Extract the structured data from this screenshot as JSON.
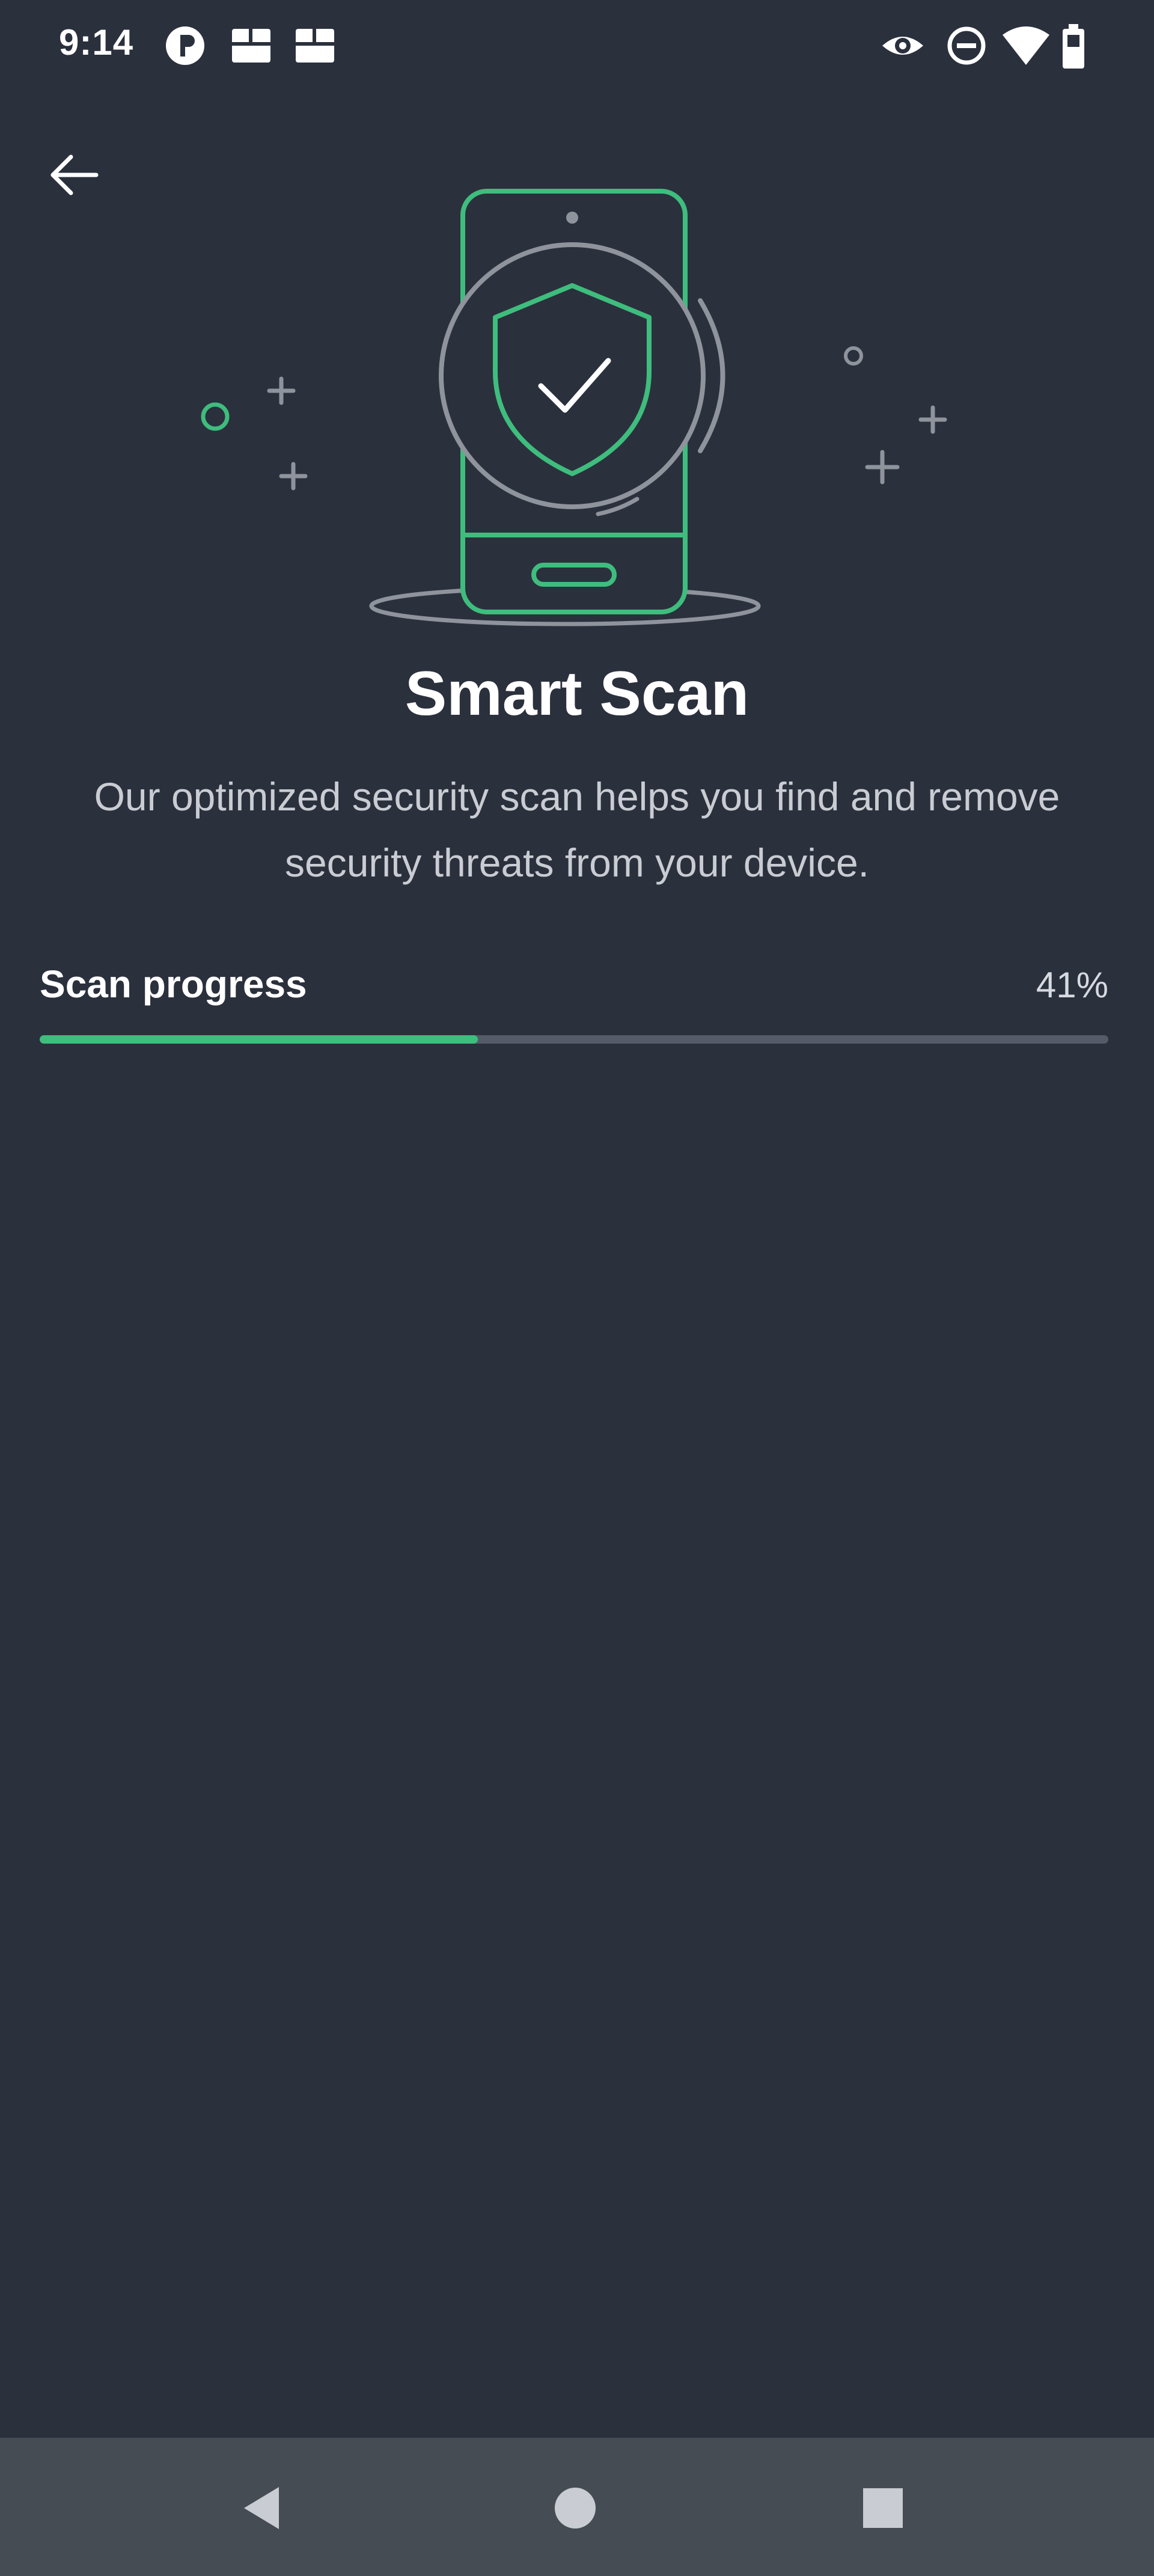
{
  "status_bar": {
    "time": "9:14",
    "left_icons": [
      "app-notification-icon",
      "image-notification-icon",
      "image-notification-icon"
    ],
    "right_icons": [
      "eye-icon",
      "do-not-disturb-icon",
      "wifi-icon",
      "battery-icon"
    ]
  },
  "header": {
    "back_icon": "arrow-left-icon"
  },
  "hero": {
    "illustration": "phone-shield-check-illustration"
  },
  "main": {
    "title": "Smart Scan",
    "subtitle": "Our optimized security scan helps you find and remove security threats from your device."
  },
  "progress": {
    "label": "Scan progress",
    "value_text": "41%",
    "fraction": 0.41
  },
  "nav_bar": {
    "buttons": [
      "back-triangle-icon",
      "home-circle-icon",
      "recents-square-icon"
    ]
  },
  "colors": {
    "background": "#2b303d",
    "accent_green": "#3ebd7d",
    "track": "#555b68",
    "nav_bar": "#464c53"
  }
}
